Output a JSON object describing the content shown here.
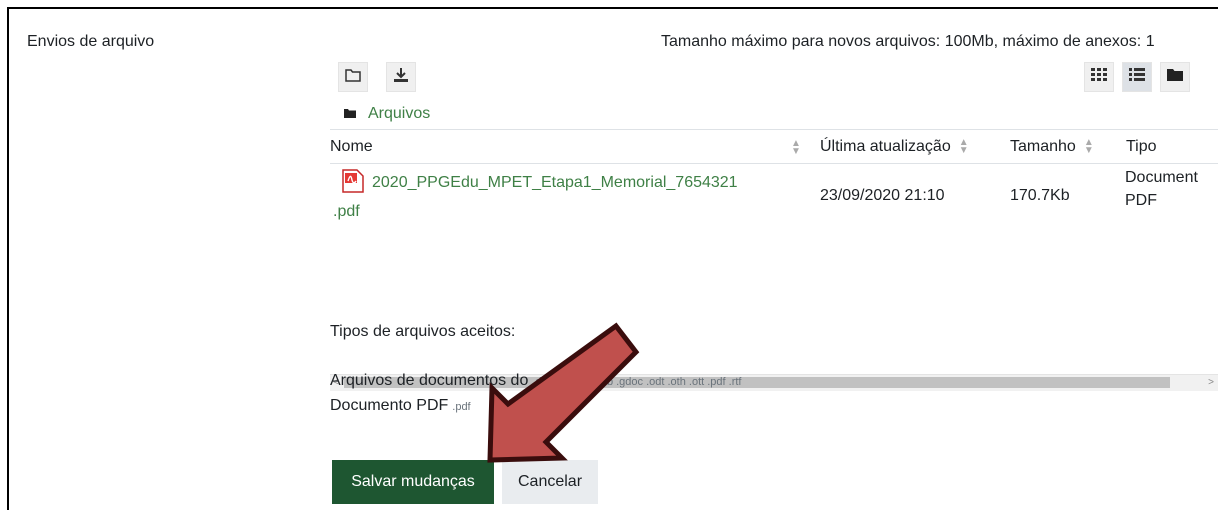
{
  "form": {
    "label": "Envios de arquivo"
  },
  "limits": {
    "text": "Tamanho máximo para novos arquivos: 100Mb, máximo de anexos: 1"
  },
  "toolbar": {
    "left_icons": [
      "folder-outline-icon",
      "download-icon"
    ],
    "right_icons": [
      "grid-view-icon",
      "list-view-icon",
      "tree-view-icon"
    ],
    "active_view": "list-view-icon"
  },
  "path": {
    "folder_icon": "folder-icon",
    "label": "Arquivos"
  },
  "table": {
    "columns": [
      "Nome",
      "Última atualização",
      "Tamanho",
      "Tipo"
    ],
    "rows": [
      {
        "name_line1": "2020_PPGEdu_MPET_Etapa1_Memorial_7654321",
        "name_line2": ".pdf",
        "icon": "pdf-icon",
        "updated": "23/09/2020 21:10",
        "size": "170.7Kb",
        "type_line1": "Document",
        "type_line2": "PDF"
      }
    ]
  },
  "accepted": {
    "title": "Tipos de arquivos aceitos:",
    "groups": [
      {
        "label": "Arquivos de documentos do",
        "extensions": ".doc .docx .epub .gdoc .odt .oth .ott .pdf .rtf"
      },
      {
        "label": "Documento PDF",
        "extensions": ".pdf"
      }
    ]
  },
  "actions": {
    "save": "Salvar mudanças",
    "cancel": "Cancelar"
  },
  "colors": {
    "accent": "#1e5631",
    "link": "#3f8046",
    "annotation_arrow": "#c0504d"
  }
}
